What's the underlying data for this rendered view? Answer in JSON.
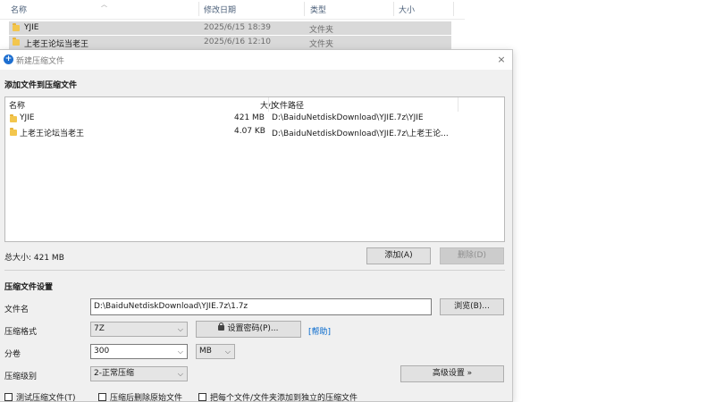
{
  "explorer": {
    "columns": {
      "name": "名称",
      "date": "修改日期",
      "type": "类型",
      "size": "大小"
    },
    "rows": [
      {
        "name": "YJIE",
        "date": "2025/6/15 18:39",
        "type": "文件夹"
      },
      {
        "name": "上老王论坛当老王",
        "date": "2025/6/16 12:10",
        "type": "文件夹"
      }
    ]
  },
  "dialog": {
    "title": "新建压缩文件",
    "close": "×",
    "add_section_title": "添加文件到压缩文件",
    "list_headers": {
      "name": "名称",
      "size": "大小",
      "path": "文件路径"
    },
    "files": [
      {
        "name": "YJIE",
        "size": "421 MB",
        "path": "D:\\BaiduNetdiskDownload\\YJIE.7z\\YJIE"
      },
      {
        "name": "上老王论坛当老王",
        "size": "4.07 KB",
        "path": "D:\\BaiduNetdiskDownload\\YJIE.7z\\上老王论..."
      }
    ],
    "total_size": "总大小: 421 MB",
    "add_button": "添加(A)",
    "delete_button": "删除(D)",
    "settings_title": "压缩文件设置",
    "filename_label": "文件名",
    "filename_value": "D:\\BaiduNetdiskDownload\\YJIE.7z\\1.7z",
    "browse_button": "浏览(B)...",
    "format_label": "压缩格式",
    "format_value": "7Z",
    "password_button": "设置密码(P)...",
    "help_link": "[帮助]",
    "volume_label": "分卷",
    "volume_value": "300",
    "volume_unit": "MB",
    "level_label": "压缩级别",
    "level_value": "2-正常压缩",
    "advanced_button": "高级设置 »",
    "checkboxes": {
      "test": "测试压缩文件(T)",
      "delete_after": "压缩后删除原始文件",
      "each_separate": "把每个文件/文件夹添加到独立的压缩文件"
    }
  }
}
